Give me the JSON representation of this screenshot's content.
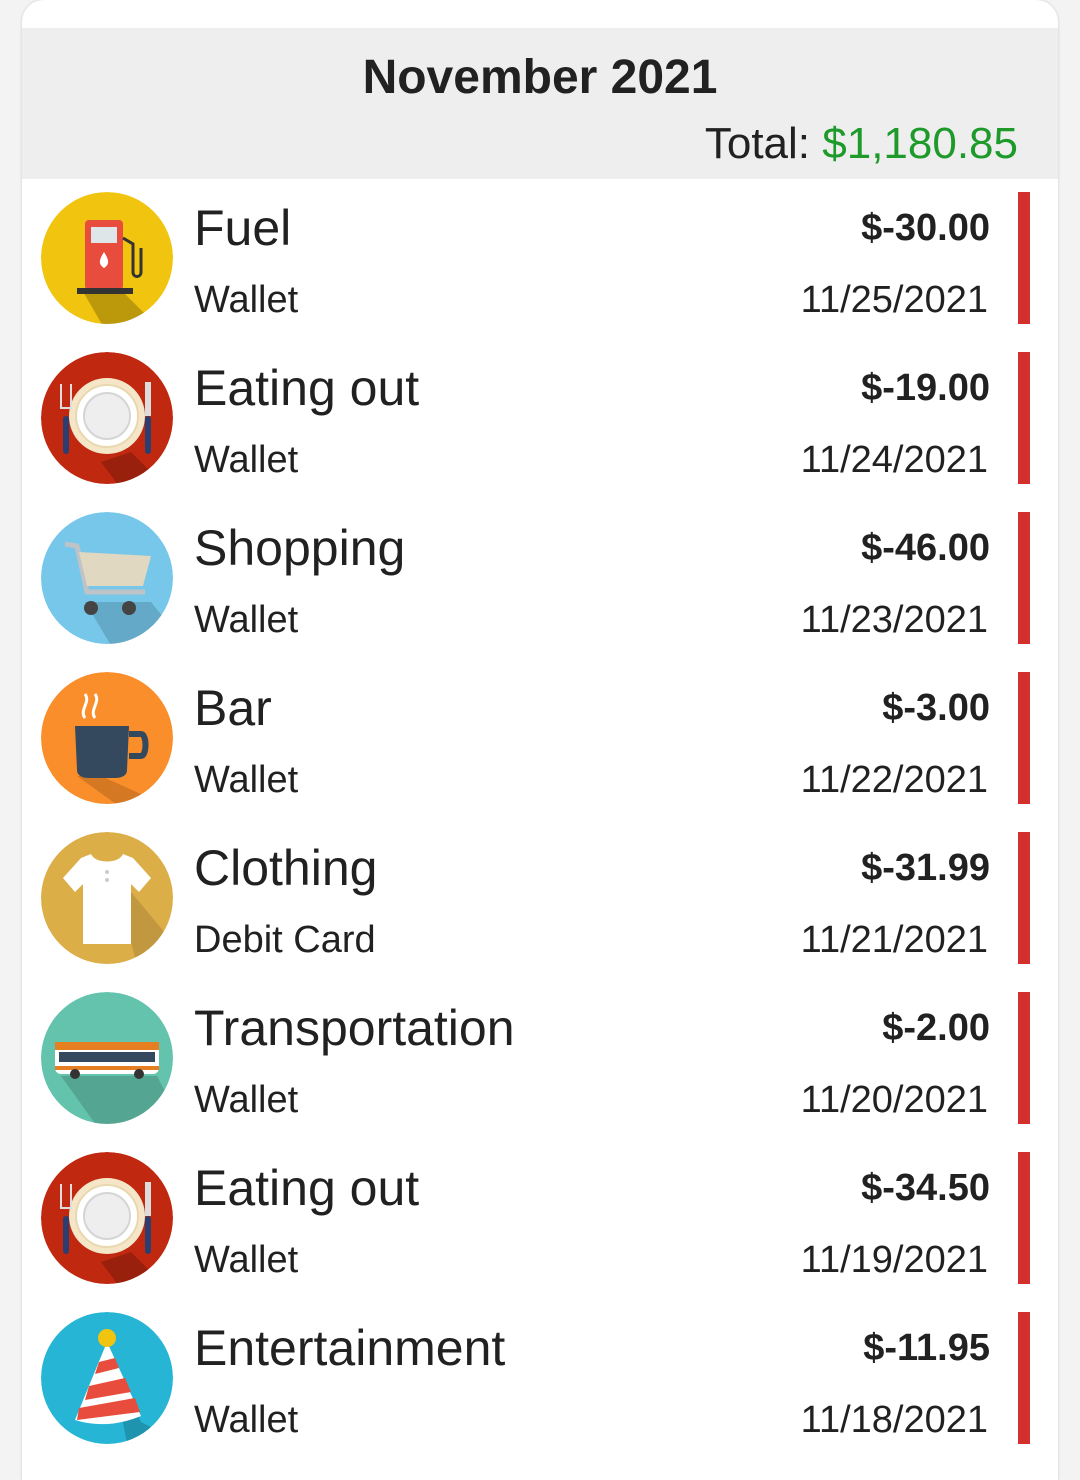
{
  "header": {
    "month_title": "November 2021",
    "total_label": "Total:",
    "total_amount": "$1,180.85",
    "total_color": "#1e9a2a"
  },
  "expense_bar_color": "#d32f2f",
  "transactions": [
    {
      "category": "Fuel",
      "account": "Wallet",
      "amount": "$-30.00",
      "date": "11/25/2021",
      "icon": "fuel-pump-icon",
      "icon_bg": "#f1c40f"
    },
    {
      "category": "Eating out",
      "account": "Wallet",
      "amount": "$-19.00",
      "date": "11/24/2021",
      "icon": "plate-cutlery-icon",
      "icon_bg": "#c0280f"
    },
    {
      "category": "Shopping",
      "account": "Wallet",
      "amount": "$-46.00",
      "date": "11/23/2021",
      "icon": "shopping-cart-icon",
      "icon_bg": "#76c7ea"
    },
    {
      "category": "Bar",
      "account": "Wallet",
      "amount": "$-3.00",
      "date": "11/22/2021",
      "icon": "coffee-cup-icon",
      "icon_bg": "#f98e2b"
    },
    {
      "category": "Clothing",
      "account": "Debit Card",
      "amount": "$-31.99",
      "date": "11/21/2021",
      "icon": "tshirt-icon",
      "icon_bg": "#dcae48"
    },
    {
      "category": "Transportation",
      "account": "Wallet",
      "amount": "$-2.00",
      "date": "11/20/2021",
      "icon": "bus-icon",
      "icon_bg": "#63c3ad"
    },
    {
      "category": "Eating out",
      "account": "Wallet",
      "amount": "$-34.50",
      "date": "11/19/2021",
      "icon": "plate-cutlery-icon",
      "icon_bg": "#c0280f"
    },
    {
      "category": "Entertainment",
      "account": "Wallet",
      "amount": "$-11.95",
      "date": "11/18/2021",
      "icon": "party-hat-icon",
      "icon_bg": "#27b5d6"
    }
  ]
}
